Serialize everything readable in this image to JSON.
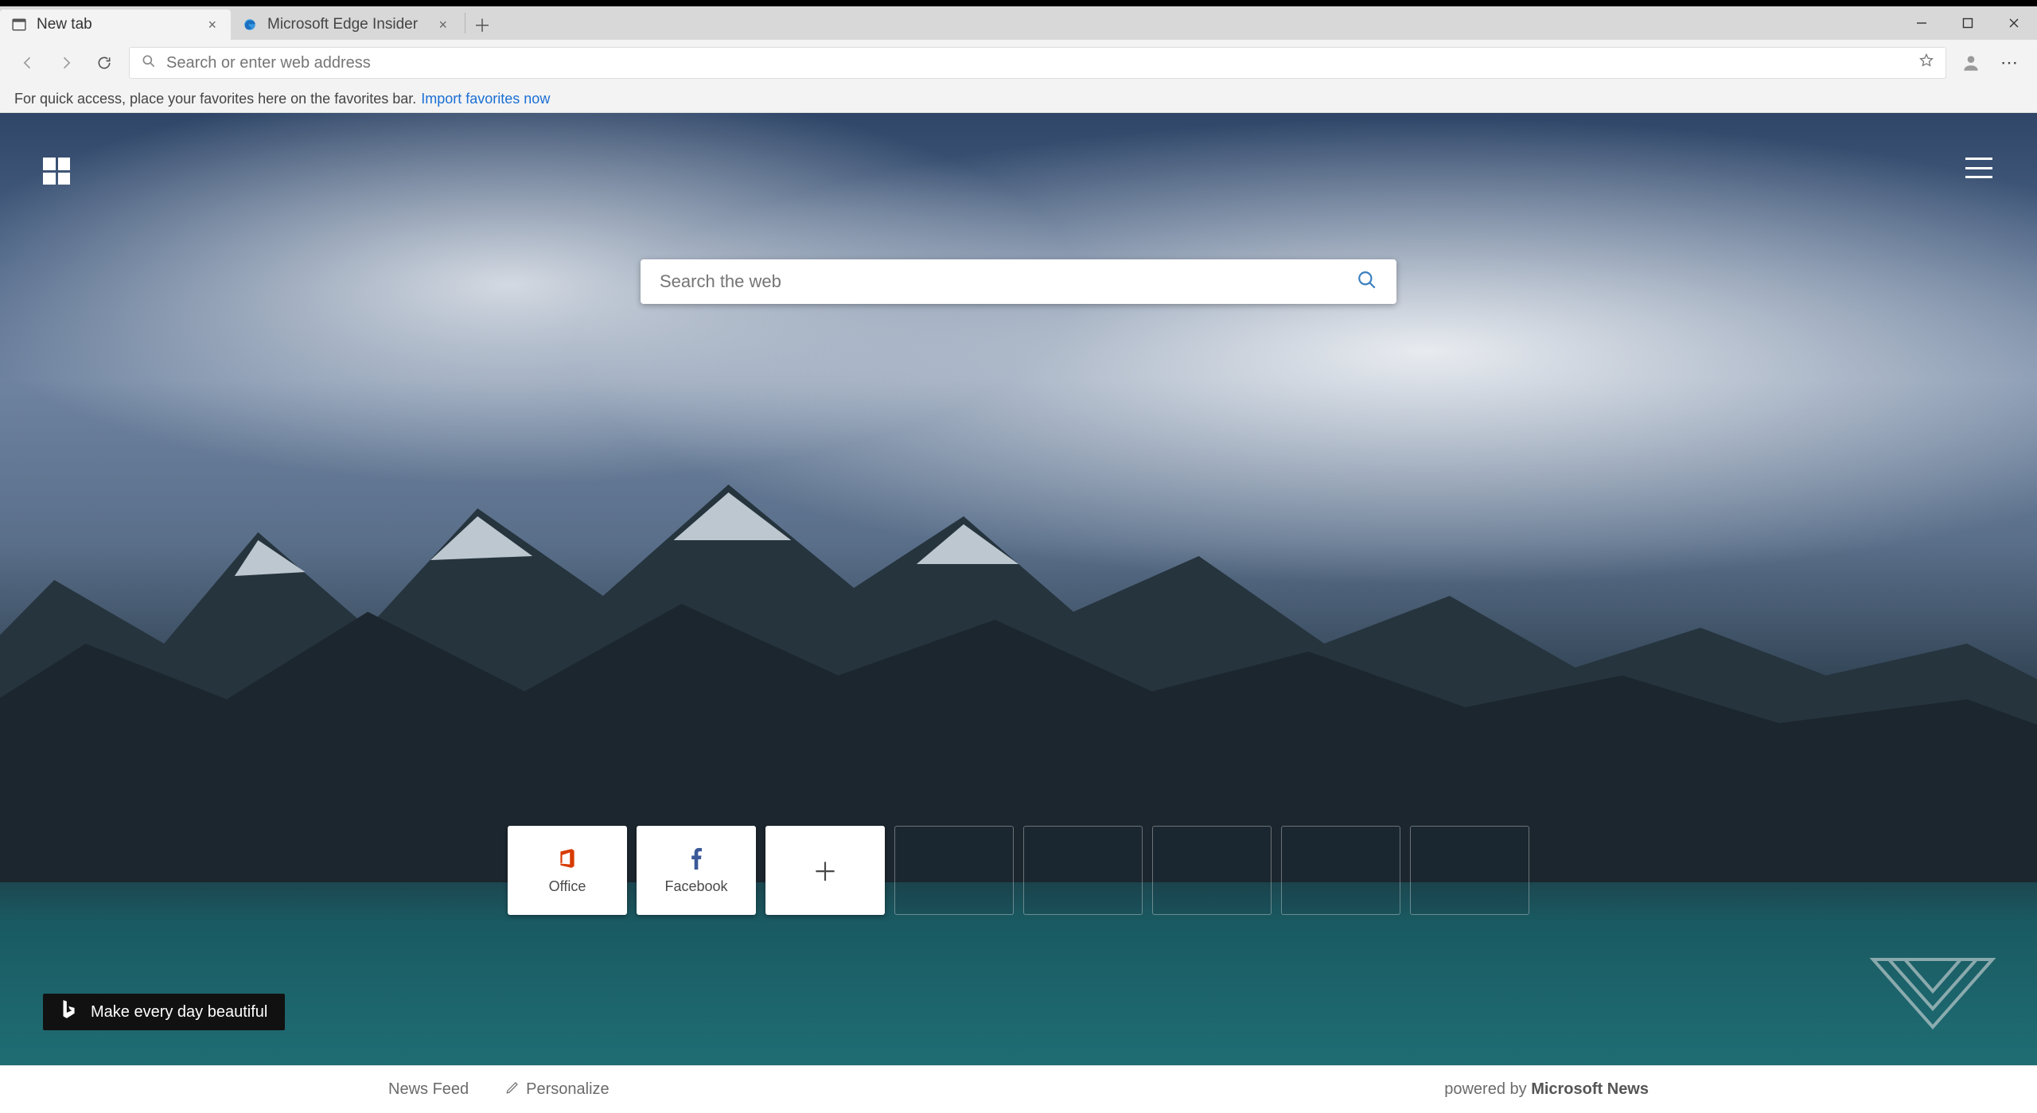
{
  "tabs": [
    {
      "title": "New tab",
      "active": true
    },
    {
      "title": "Microsoft Edge Insider",
      "active": false
    }
  ],
  "addressbar": {
    "placeholder": "Search or enter web address"
  },
  "favorites_hint": {
    "text": "For quick access, place your favorites here on the favorites bar.",
    "link_text": "Import favorites now"
  },
  "newtab": {
    "search_placeholder": "Search the web",
    "tiles": [
      {
        "label": "Office",
        "icon": "office"
      },
      {
        "label": "Facebook",
        "icon": "facebook"
      }
    ],
    "bing_badge": "Make every day beautiful"
  },
  "bottom": {
    "newsfeed": "News Feed",
    "personalize": "Personalize",
    "powered_prefix": "powered by ",
    "powered_brand": "Microsoft News"
  }
}
